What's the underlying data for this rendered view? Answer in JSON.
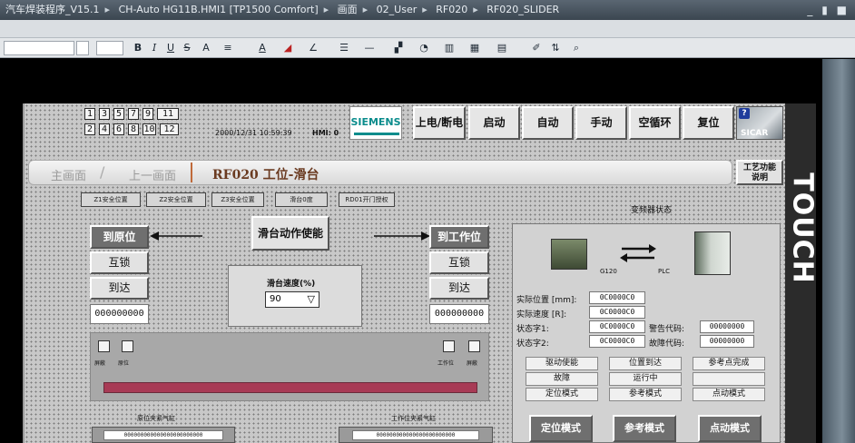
{
  "title_bar": {
    "crumbs": [
      "汽车焊装程序_V15.1",
      "CH-Auto HG11B.HMI1 [TP1500 Comfort]",
      "画面",
      "02_User",
      "RF020",
      "RF020_SLIDER"
    ],
    "window_controls": "_ ▮ ■"
  },
  "toolbar": {
    "bold": "B",
    "italic": "I",
    "underline": "U",
    "strike": "S",
    "superscript": "A",
    "align": "≡",
    "font_color": "A",
    "fill": "◢",
    "line_color": "∠"
  },
  "hmi": {
    "screen_grid": {
      "top_row": [
        "1",
        "3",
        "5",
        "7",
        "9",
        "11"
      ],
      "bottom_row": [
        "2",
        "4",
        "6",
        "8",
        "10",
        "12"
      ]
    },
    "datetime": "2000/12/31 10:59:39",
    "hmi_label": "HMI: 0",
    "brand": "SIEMENS",
    "top_buttons": [
      "上电/断电",
      "启动",
      "自动",
      "手动",
      "空循环",
      "复位"
    ],
    "sicar": "SICAR",
    "breadcrumb": {
      "main": "主画面",
      "prev": "上一画面",
      "current": "RF020 工位-滑台"
    },
    "help_button": "工艺功能\n说明",
    "safety_buttons": [
      "Z1安全位置",
      "Z2安全位置",
      "Z3安全位置",
      "滑台0度",
      "RD01开门授权"
    ],
    "origin_button": "到原位",
    "origin_interlock": "互锁",
    "origin_arrive": "到达",
    "origin_value": "000000000",
    "work_button": "到工作位",
    "work_interlock": "互锁",
    "work_arrive": "到达",
    "work_value": "000000000",
    "enable_button": "滑台动作使能",
    "speed_label": "滑台速度(%)",
    "speed_value": "90",
    "speed_arrow": "▽",
    "indicators_left": [
      "屏蔽",
      "原位"
    ],
    "indicators_right": [
      "工作位",
      "屏蔽"
    ],
    "cyl_left_label": "原位夹紧气缸",
    "cyl_right_label": "工作位夹紧气缸",
    "cyl_left_value": "000000000000000000000000",
    "cyl_right_value": "000000000000000000000000",
    "inverter": {
      "title": "变频器状态",
      "left_caption": "G120",
      "right_caption": "PLC",
      "actual_pos_label": "实际位置 [mm]:",
      "actual_pos": "0C0000C0",
      "actual_speed_label": "实际速度 [R]:",
      "actual_speed": "0C0000C0",
      "status1_label": "状态字1:",
      "status1": "0C0000C0",
      "status2_label": "状态字2:",
      "status2": "0C0000C0",
      "alarm_label": "警告代码:",
      "alarm": "00000000",
      "fault_label": "故障代码:",
      "fault": "00000000",
      "status": [
        "驱动使能",
        "位置到达",
        "参考点完成",
        "故障",
        "运行中",
        "",
        "定位模式",
        "参考模式",
        "点动模式"
      ],
      "mode_buttons": [
        "定位模式",
        "参考模式",
        "点动模式"
      ]
    },
    "touch_label": "TOUCH"
  },
  "colors": {
    "accent": "#a83a55",
    "panel": "#c8c8c8"
  }
}
